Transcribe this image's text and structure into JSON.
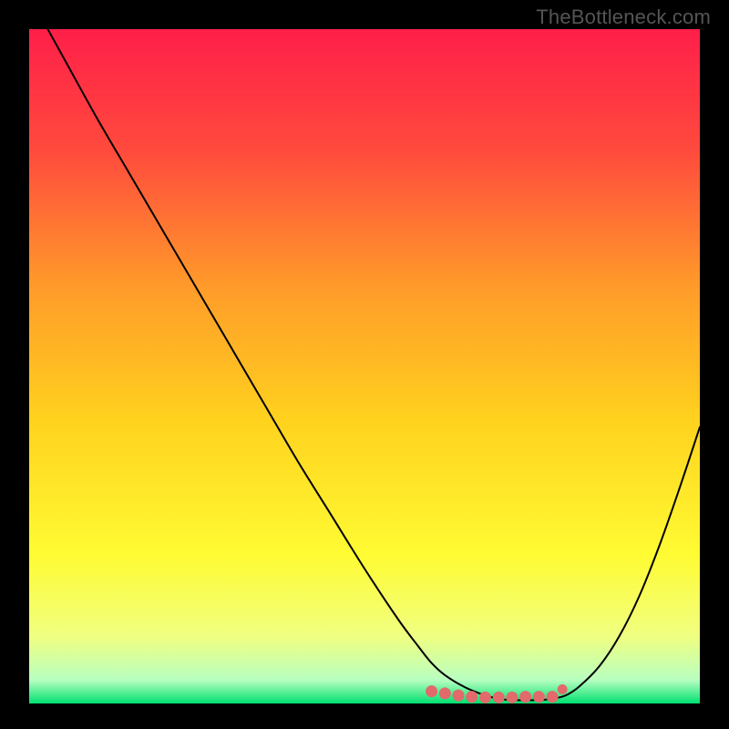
{
  "branding": "TheBottleneck.com",
  "colors": {
    "accent_marker": "#e26a6a",
    "curve": "#000000",
    "frame": "#000000"
  },
  "chart_data": {
    "type": "line",
    "title": "",
    "xlabel": "",
    "ylabel": "",
    "xlim": [
      0,
      100
    ],
    "ylim": [
      0,
      100
    ],
    "grid": false,
    "legend": false,
    "gradient_stops": [
      {
        "pos": 0.0,
        "color": "#ff1f49"
      },
      {
        "pos": 0.18,
        "color": "#ff4a3d"
      },
      {
        "pos": 0.38,
        "color": "#ff9a2a"
      },
      {
        "pos": 0.58,
        "color": "#ffd21e"
      },
      {
        "pos": 0.78,
        "color": "#fffb33"
      },
      {
        "pos": 0.9,
        "color": "#f0ff80"
      },
      {
        "pos": 0.965,
        "color": "#b8ffc0"
      },
      {
        "pos": 1.0,
        "color": "#00e070"
      }
    ],
    "series": [
      {
        "name": "bottleneck-curve",
        "x": [
          0,
          5,
          10,
          15,
          20,
          25,
          30,
          35,
          40,
          45,
          50,
          55,
          58,
          60,
          62,
          65,
          68,
          70,
          72,
          74,
          76,
          78,
          80,
          82,
          85,
          88,
          91,
          94,
          97,
          100
        ],
        "y": [
          105,
          96,
          87,
          78.5,
          70,
          61.5,
          53,
          44.5,
          36,
          28,
          20,
          12.5,
          8.5,
          6,
          4.2,
          2.4,
          1.2,
          0.7,
          0.5,
          0.5,
          0.5,
          0.7,
          1.2,
          2.5,
          5.5,
          10,
          16,
          23.5,
          32,
          41
        ]
      }
    ],
    "markers": {
      "name": "highlight-band",
      "color": "#e26a6a",
      "x": [
        60,
        62,
        64,
        66,
        68,
        70,
        72,
        74,
        76,
        78,
        79.5
      ],
      "y": [
        1.8,
        1.5,
        1.2,
        1.0,
        0.9,
        0.9,
        0.9,
        1.0,
        1.0,
        1.0,
        2.1
      ]
    }
  }
}
